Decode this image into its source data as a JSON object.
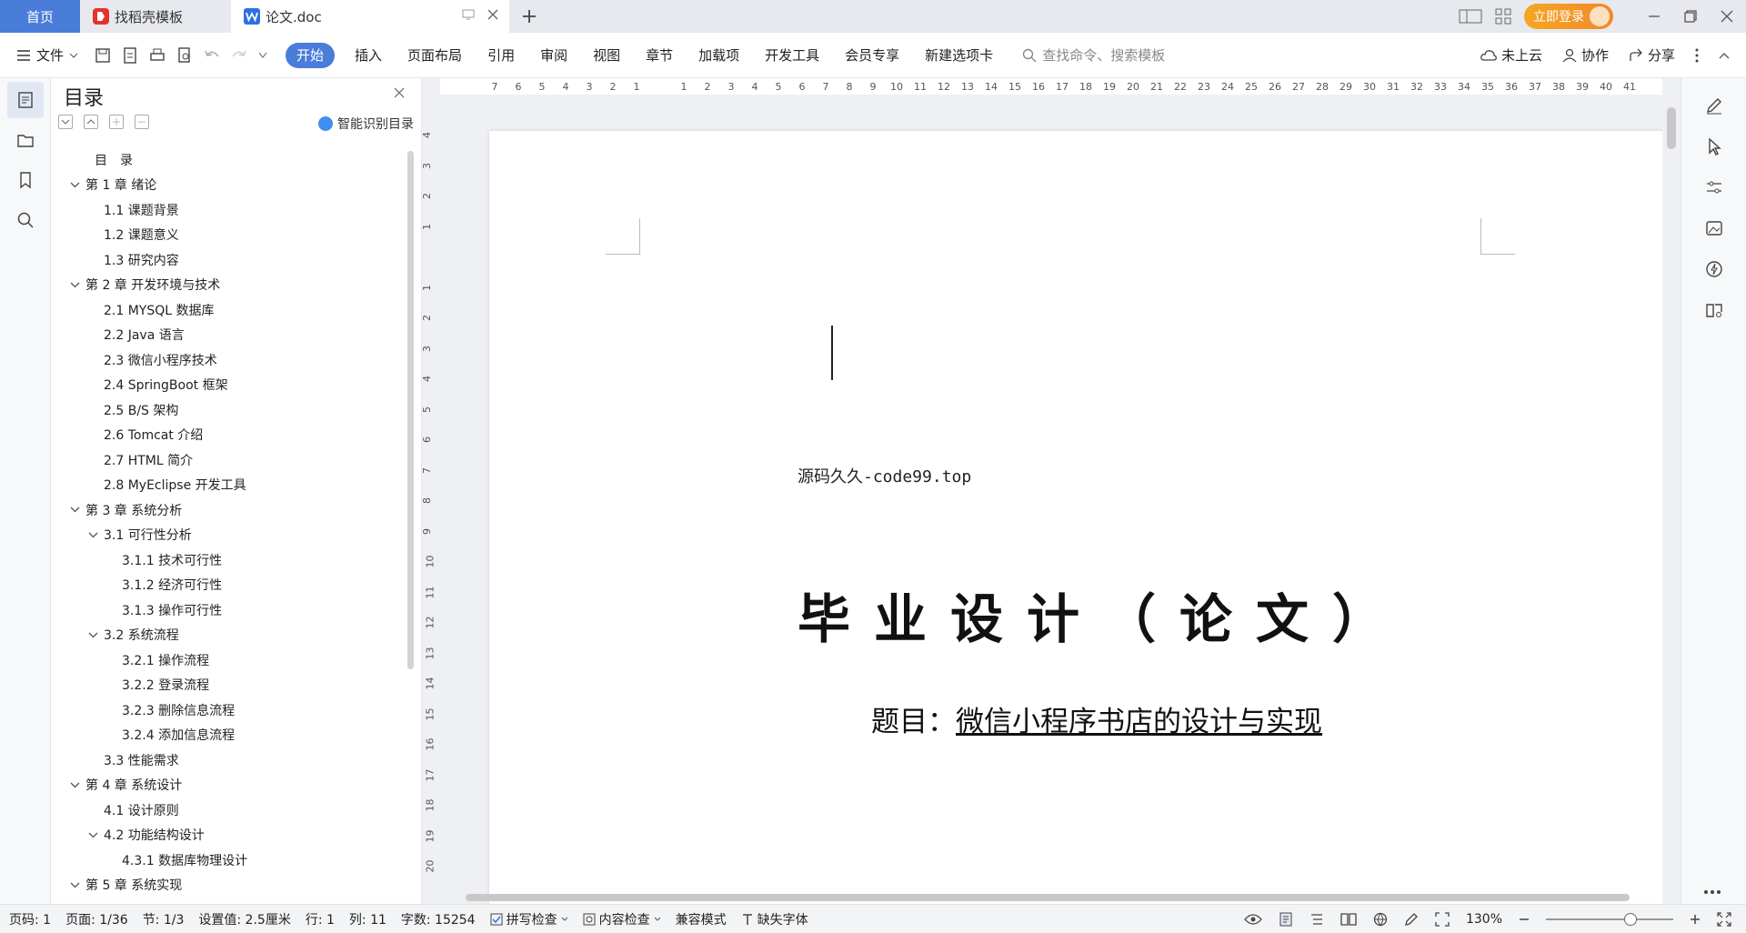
{
  "tabs": {
    "home": "首页",
    "templates": "找稻壳模板",
    "doc": "论文.doc",
    "login": "立即登录"
  },
  "ribbon": {
    "file": "文件",
    "menu": [
      "开始",
      "插入",
      "页面布局",
      "引用",
      "审阅",
      "视图",
      "章节",
      "加载项",
      "开发工具",
      "会员专享",
      "新建选项卡"
    ],
    "search_placeholder": "查找命令、搜索模板",
    "cloud": "未上云",
    "collab": "协作",
    "share": "分享"
  },
  "toc": {
    "title": "目录",
    "smart": "智能识别目录",
    "items": [
      {
        "level": 0,
        "text": "目　录",
        "chevron": false
      },
      {
        "level": 0,
        "text": "第 1 章  绪论",
        "chevron": true
      },
      {
        "level": 1,
        "text": "1.1  课题背景",
        "chevron": false
      },
      {
        "level": 1,
        "text": "1.2  课题意义",
        "chevron": false
      },
      {
        "level": 1,
        "text": "1.3  研究内容",
        "chevron": false
      },
      {
        "level": 0,
        "text": "第 2 章  开发环境与技术",
        "chevron": true
      },
      {
        "level": 1,
        "text": "2.1 MYSQL 数据库",
        "chevron": false
      },
      {
        "level": 1,
        "text": "2.2 Java 语言",
        "chevron": false
      },
      {
        "level": 1,
        "text": "2.3  微信小程序技术",
        "chevron": false
      },
      {
        "level": 1,
        "text": "2.4 SpringBoot 框架",
        "chevron": false
      },
      {
        "level": 1,
        "text": "2.5 B/S 架构",
        "chevron": false
      },
      {
        "level": 1,
        "text": "2.6 Tomcat  介绍",
        "chevron": false
      },
      {
        "level": 1,
        "text": "2.7 HTML 简介",
        "chevron": false
      },
      {
        "level": 1,
        "text": "2.8 MyEclipse 开发工具",
        "chevron": false
      },
      {
        "level": 0,
        "text": "第 3 章  系统分析",
        "chevron": true
      },
      {
        "level": 1,
        "text": "3.1  可行性分析",
        "chevron": true
      },
      {
        "level": 2,
        "text": "3.1.1  技术可行性",
        "chevron": false
      },
      {
        "level": 2,
        "text": "3.1.2  经济可行性",
        "chevron": false
      },
      {
        "level": 2,
        "text": "3.1.3  操作可行性",
        "chevron": false
      },
      {
        "level": 1,
        "text": "3.2  系统流程",
        "chevron": true
      },
      {
        "level": 2,
        "text": "3.2.1  操作流程",
        "chevron": false
      },
      {
        "level": 2,
        "text": "3.2.2  登录流程",
        "chevron": false
      },
      {
        "level": 2,
        "text": "3.2.3  删除信息流程",
        "chevron": false
      },
      {
        "level": 2,
        "text": "3.2.4  添加信息流程",
        "chevron": false
      },
      {
        "level": 1,
        "text": "3.3  性能需求",
        "chevron": false
      },
      {
        "level": 0,
        "text": "第 4 章  系统设计",
        "chevron": true
      },
      {
        "level": 1,
        "text": "4.1  设计原则",
        "chevron": false
      },
      {
        "level": 1,
        "text": "4.2  功能结构设计",
        "chevron": true
      },
      {
        "level": 2,
        "text": "4.3.1  数据库物理设计",
        "chevron": false
      },
      {
        "level": 0,
        "text": "第 5 章  系统实现",
        "chevron": true
      }
    ]
  },
  "ruler": {
    "h": [
      "7",
      "6",
      "5",
      "4",
      "3",
      "2",
      "1",
      "",
      "1",
      "2",
      "3",
      "4",
      "5",
      "6",
      "7",
      "8",
      "9",
      "10",
      "11",
      "12",
      "13",
      "14",
      "15",
      "16",
      "17",
      "18",
      "19",
      "20",
      "21",
      "22",
      "23",
      "24",
      "25",
      "26",
      "27",
      "28",
      "29",
      "30",
      "31",
      "32",
      "33",
      "34",
      "35",
      "36",
      "37",
      "38",
      "39",
      "40",
      "41"
    ],
    "v": [
      "4",
      "3",
      "2",
      "1",
      "",
      "1",
      "2",
      "3",
      "4",
      "5",
      "6",
      "7",
      "8",
      "9",
      "10",
      "11",
      "12",
      "13",
      "14",
      "15",
      "16",
      "17",
      "18",
      "19",
      "20"
    ]
  },
  "doc": {
    "source": "源码久久-code99.top",
    "title": "毕业设计（论文）",
    "subject_label": "题目：",
    "subject_value": "微信小程序书店的设计与实现"
  },
  "status": {
    "page": "页码: 1",
    "pages": "页面: 1/36",
    "section": "节: 1/3",
    "setting": "设置值: 2.5厘米",
    "row": "行: 1",
    "col": "列: 11",
    "words": "字数: 15254",
    "spell": "拼写检查",
    "content_check": "内容检查",
    "compat": "兼容模式",
    "missing_font": "缺失字体",
    "zoom": "130%"
  }
}
